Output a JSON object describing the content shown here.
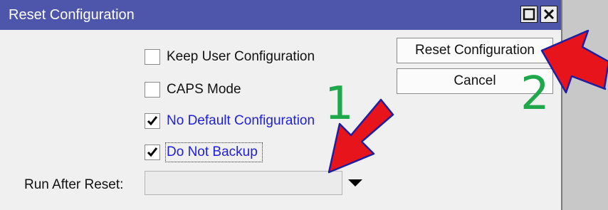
{
  "window": {
    "title": "Reset Configuration"
  },
  "checkboxes": [
    {
      "label": "Keep User Configuration",
      "checked": false
    },
    {
      "label": "CAPS Mode",
      "checked": false
    },
    {
      "label": "No Default Configuration",
      "checked": true
    },
    {
      "label": "Do Not Backup",
      "checked": true
    }
  ],
  "buttons": {
    "reset_label": "Reset Configuration",
    "cancel_label": "Cancel"
  },
  "run_after_reset": {
    "label": "Run After Reset:",
    "value": ""
  },
  "annotations": {
    "step1": "1",
    "step2": "2"
  },
  "colors": {
    "titlebar": "#4d56aa",
    "blue_label": "#1f1fd8",
    "annotation_green": "#1fa84b",
    "annotation_arrow": "#e8141c"
  },
  "icons": {
    "maximize": "square-icon",
    "close": "close-icon",
    "dropdown": "triangle-down-icon",
    "check": "checkmark-icon"
  }
}
